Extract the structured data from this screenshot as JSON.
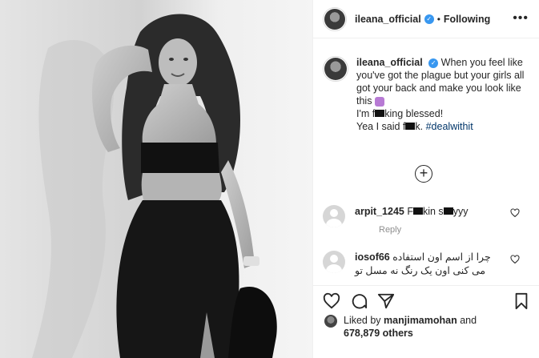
{
  "post": {
    "username": "ileana_official",
    "separator": "•",
    "follow_status": "Following",
    "more_label": "•••"
  },
  "caption": {
    "username": "ileana_official",
    "line1": "When you feel like you've got the plague but your girls all got your back and make you look like this",
    "line2a": "I'm f",
    "line2b": "king blessed!",
    "line3a": "Yea I said f",
    "line3b": "k.",
    "hashtag": "#dealwithit"
  },
  "load_more": {
    "label": "+"
  },
  "comments": [
    {
      "username": "arpit_1245",
      "text_a": "F",
      "text_b": "kin s",
      "text_c": "yyy",
      "reply_label": "Reply"
    },
    {
      "username": "iosof66",
      "text": "چرا از اسم اون استفاده می کنی اون یک رنگ نه مسل تو"
    }
  ],
  "actions": {
    "icons": [
      "heart-icon",
      "comment-icon",
      "share-icon",
      "bookmark-icon"
    ]
  },
  "likes": {
    "prefix": "Liked by",
    "liker": "manjimamohan",
    "joiner": "and",
    "count": "678,879 others"
  },
  "colors": {
    "link": "#003569",
    "verified": "#3897f0",
    "muted": "#8e8e8e"
  }
}
